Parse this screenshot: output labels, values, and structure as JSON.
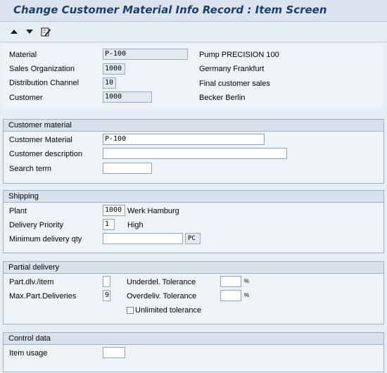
{
  "window": {
    "title": "Change Customer Material Info Record : Item Screen"
  },
  "toolbar": {
    "icons": [
      "arrow-up-icon",
      "arrow-down-icon",
      "edit-icon"
    ]
  },
  "header": {
    "material_label": "Material",
    "material_value": "P-100",
    "material_desc": "Pump PRECISION 100",
    "salesorg_label": "Sales Organization",
    "salesorg_value": "1000",
    "salesorg_desc": "Germany Frankfurt",
    "distch_label": "Distribution Channel",
    "distch_value": "10",
    "distch_desc": "Final customer sales",
    "customer_label": "Customer",
    "customer_value": "1000",
    "customer_desc": "Becker Berlin"
  },
  "customer_material": {
    "title": "Customer material",
    "cust_mat_label": "Customer Material",
    "cust_mat_value": "P-100",
    "cust_desc_label": "Customer description",
    "cust_desc_value": "",
    "search_label": "Search term",
    "search_value": ""
  },
  "shipping": {
    "title": "Shipping",
    "plant_label": "Plant",
    "plant_value": "1000",
    "plant_desc": "Werk Hamburg",
    "delprio_label": "Delivery Priority",
    "delprio_value": "1",
    "delprio_desc": "High",
    "minqty_label": "Minimum delivery qty",
    "minqty_value": "",
    "minqty_unit": "PC"
  },
  "partial_delivery": {
    "title": "Partial delivery",
    "partdlv_label": "Part.dlv./item",
    "partdlv_value": "",
    "maxpart_label": "Max.Part.Deliveries",
    "maxpart_value": "9",
    "underdel_label": "Underdel. Tolerance",
    "underdel_value": "",
    "underdel_unit": "%",
    "overdel_label": "Overdeliv. Tolerance",
    "overdel_value": "",
    "overdel_unit": "%",
    "unlimited_label": "Unlimited tolerance"
  },
  "control_data": {
    "title": "Control data",
    "usage_label": "Item usage",
    "usage_value": ""
  }
}
